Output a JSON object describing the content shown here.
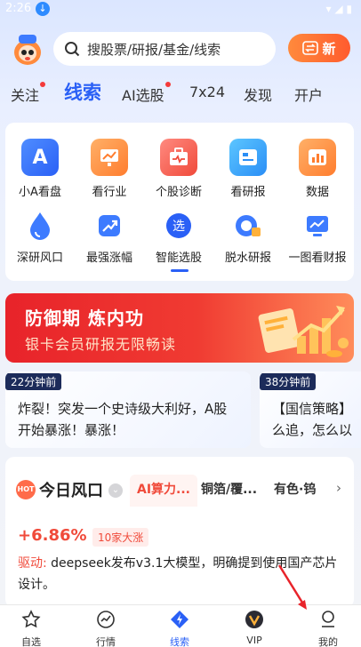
{
  "status": {
    "time": "2:26"
  },
  "search": {
    "placeholder": "搜股票/研报/基金/线索"
  },
  "new_button": {
    "label": "新"
  },
  "tabs": [
    {
      "label": "关注",
      "dot": true
    },
    {
      "label": "线索",
      "active": true
    },
    {
      "label": "AI选股",
      "dot": true
    },
    {
      "label": "7x24"
    },
    {
      "label": "发现"
    },
    {
      "label": "开户"
    }
  ],
  "grid": [
    {
      "label": "小A看盘",
      "icon": "a-letter-icon"
    },
    {
      "label": "看行业",
      "icon": "trend-board-icon"
    },
    {
      "label": "个股诊断",
      "icon": "medical-kit-icon"
    },
    {
      "label": "看研报",
      "icon": "report-icon"
    },
    {
      "label": "数据",
      "icon": "bar-chart-icon"
    },
    {
      "label": "深研风口",
      "icon": "water-drop-icon"
    },
    {
      "label": "最强涨幅",
      "icon": "rising-arrow-icon"
    },
    {
      "label": "智能选股",
      "icon": "select-icon",
      "glyph": "选"
    },
    {
      "label": "脱水研报",
      "icon": "hourglass-icon"
    },
    {
      "label": "一图看财报",
      "icon": "chart-image-icon"
    }
  ],
  "banner": {
    "title": "防御期  炼内功",
    "subtitle": "银卡会员研报无限畅读"
  },
  "news": [
    {
      "ago": "22分钟前",
      "text": "炸裂！突发一个史诗级大利好，A股开始暴涨！暴涨！"
    },
    {
      "ago": "38分钟前",
      "text": "【国信策略】么追，怎么以"
    }
  ],
  "hot": {
    "title": "今日风口",
    "icon_text": "HOT",
    "tabs": [
      "AI算力...",
      "铜箔/覆...",
      "有色·钨"
    ],
    "change": "+6.86%",
    "badge": "10家大涨",
    "driver_label": "驱动:",
    "driver_text": "deepseek发布v3.1大模型，明确提到使用国产芯片设计。"
  },
  "nav": [
    {
      "label": "自选",
      "icon": "star-icon"
    },
    {
      "label": "行情",
      "icon": "market-pulse-icon"
    },
    {
      "label": "线索",
      "icon": "diamond-bolt-icon",
      "active": true
    },
    {
      "label": "VIP",
      "icon": "vip-icon"
    },
    {
      "label": "我的",
      "icon": "user-icon"
    }
  ],
  "colors": {
    "accent": "#2a60f6",
    "red": "#f04a3a",
    "banner": "#e8232a"
  }
}
